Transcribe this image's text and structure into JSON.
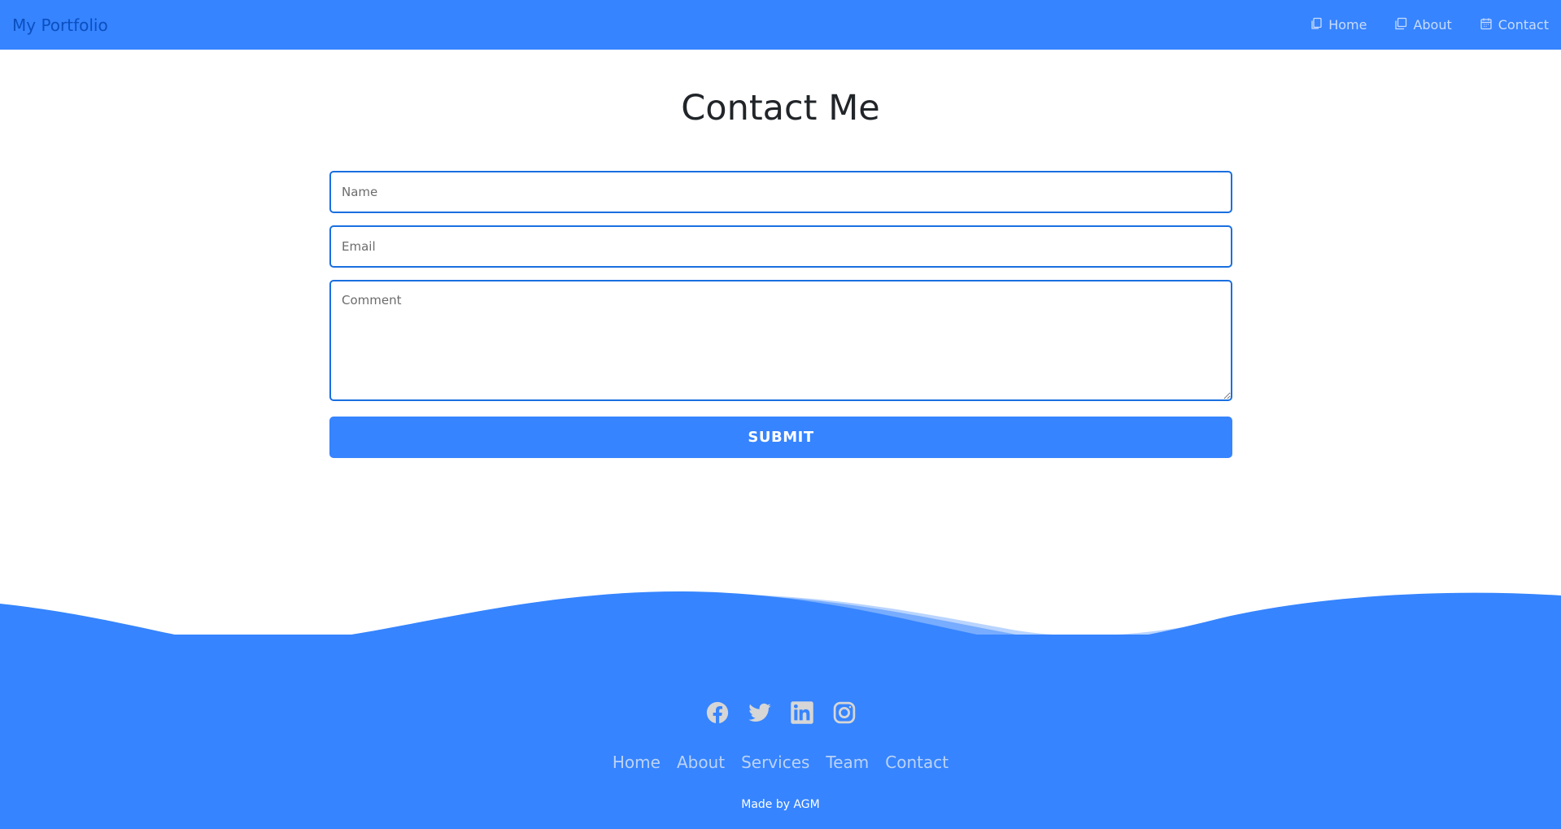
{
  "header": {
    "brand": "My Portfolio",
    "nav": [
      {
        "label": "Home",
        "icon": "home-page-icon"
      },
      {
        "label": "About",
        "icon": "about-page-icon"
      },
      {
        "label": "Contact",
        "icon": "calendar-icon"
      }
    ]
  },
  "main": {
    "title": "Contact Me",
    "form": {
      "name_placeholder": "Name",
      "email_placeholder": "Email",
      "comment_placeholder": "Comment",
      "submit_label": "SUBMIT"
    }
  },
  "footer": {
    "social": [
      "facebook-icon",
      "twitter-icon",
      "linkedin-icon",
      "instagram-icon"
    ],
    "menu": [
      "Home",
      "About",
      "Services",
      "Team",
      "Contact"
    ],
    "credit": "Made by AGM"
  },
  "colors": {
    "primary": "#3684ff",
    "brand_text": "#0b4fbf",
    "input_border": "#1a6fe0"
  }
}
